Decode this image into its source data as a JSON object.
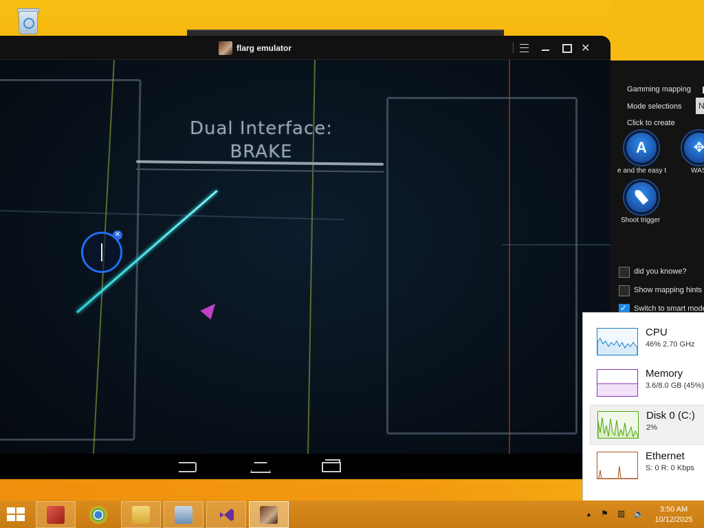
{
  "desktop": {
    "recycle_bin_icon": "recycle-bin-icon"
  },
  "emulator": {
    "title": "flarg emulator",
    "controls": {
      "menu_icon": "menu-icon",
      "minimize_icon": "minimize-icon",
      "maximize_icon": "maximize-icon",
      "close_icon": "close-icon"
    },
    "game": {
      "title_line1": "Dual Interface:",
      "title_line2": "BRAKE"
    },
    "navbar": {
      "back_icon": "android-back-icon",
      "home_icon": "android-home-icon",
      "recents_icon": "android-recents-icon"
    }
  },
  "side_panel": {
    "gaming_mapping_label": "Gamming mapping",
    "mode_selections_label": "Mode selections",
    "mode_value": "N",
    "click_to_create": "Click to create",
    "buttons": [
      {
        "glyph": "A",
        "caption": "e and the easy t",
        "icon": "a-key-icon"
      },
      {
        "glyph": "✥",
        "caption": "WAS",
        "icon": "dpad-icon"
      },
      {
        "glyph": "",
        "caption": "Shoot trigger",
        "icon": "bullet-icon"
      }
    ],
    "options": [
      {
        "label": "did you knowe?",
        "checked": false
      },
      {
        "label": "Show mapping hints s",
        "checked": false
      },
      {
        "label": "Switch to smart mode",
        "checked": true
      }
    ]
  },
  "task_manager": {
    "items": [
      {
        "name": "CPU",
        "value": "46%  2.70 GHz",
        "color": "#1a7fc1"
      },
      {
        "name": "Memory",
        "value": "3.6/8.0 GB (45%)",
        "color": "#8b2fb5"
      },
      {
        "name": "Disk 0 (C:)",
        "value": "2%",
        "color": "#4da60c"
      },
      {
        "name": "Ethernet",
        "value": "S: 0  R: 0 Kbps",
        "color": "#a7521b"
      }
    ]
  },
  "taskbar": {
    "apps": [
      {
        "name": "red-cube-app-icon",
        "color": "#c0302a"
      },
      {
        "name": "chrome-icon",
        "color": "#3b7fd6"
      },
      {
        "name": "file-explorer-icon",
        "color": "#e8c04a"
      },
      {
        "name": "remote-desktop-icon",
        "color": "#6d8eb5"
      },
      {
        "name": "visual-studio-icon",
        "color": "#6a2d9e"
      },
      {
        "name": "flarg-emulator-icon",
        "color": "#6b3a1e"
      }
    ],
    "time": "3:50 AM",
    "date": "10/12/2025"
  }
}
